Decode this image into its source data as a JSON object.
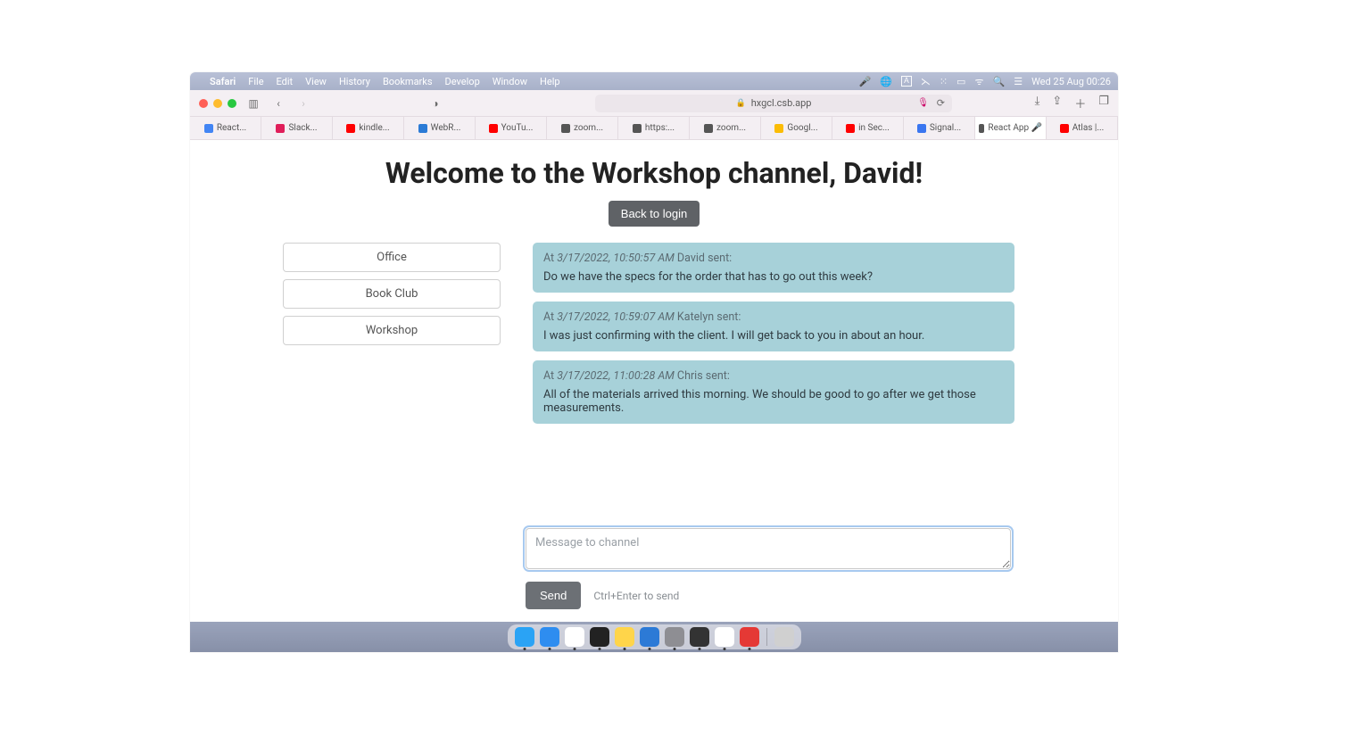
{
  "menubar": {
    "app": "Safari",
    "items": [
      "File",
      "Edit",
      "View",
      "History",
      "Bookmarks",
      "Develop",
      "Window",
      "Help"
    ],
    "clock": "Wed 25 Aug  00:26"
  },
  "toolbar": {
    "address": "hxgcl.csb.app"
  },
  "favorites": [
    {
      "label": "React...",
      "color": "#4285f4"
    },
    {
      "label": "Slack...",
      "color": "#e01e5a"
    },
    {
      "label": "kindle...",
      "color": "#ff0000"
    },
    {
      "label": "WebR...",
      "color": "#2b7bd6"
    },
    {
      "label": "YouTu...",
      "color": "#ff0000"
    },
    {
      "label": "zoom...",
      "color": "#555"
    },
    {
      "label": "https:...",
      "color": "#555"
    },
    {
      "label": "zoom...",
      "color": "#555"
    },
    {
      "label": "Googl...",
      "color": "#fbbc05"
    },
    {
      "label": "in Sec...",
      "color": "#ff0000"
    },
    {
      "label": "Signal...",
      "color": "#3a76f0"
    },
    {
      "label": "React App 🎤",
      "color": "#555",
      "active": true
    },
    {
      "label": "Atlas |...",
      "color": "#ff0000"
    }
  ],
  "page": {
    "title": "Welcome to the Workshop channel, David!",
    "back_label": "Back to login"
  },
  "channels": [
    "Office",
    "Book Club",
    "Workshop"
  ],
  "messages": [
    {
      "at_prefix": "At ",
      "timestamp": "3/17/2022, 10:50:57 AM",
      "sender_suffix": " David sent:",
      "body": "Do we have the specs for the order that has to go out this week?"
    },
    {
      "at_prefix": "At ",
      "timestamp": "3/17/2022, 10:59:07 AM",
      "sender_suffix": " Katelyn sent:",
      "body": "I was just confirming with the client. I will get back to you in about an hour."
    },
    {
      "at_prefix": "At ",
      "timestamp": "3/17/2022, 11:00:28 AM",
      "sender_suffix": " Chris sent:",
      "body": "All of the materials arrived this morning. We should be good to go after we get those measurements."
    }
  ],
  "compose": {
    "placeholder": "Message to channel",
    "send_label": "Send",
    "hint": "Ctrl+Enter to send"
  },
  "dock": {
    "apps": [
      {
        "name": "finder",
        "bg": "#2aa3f5"
      },
      {
        "name": "safari",
        "bg": "#2e8df0"
      },
      {
        "name": "chrome",
        "bg": "#fff"
      },
      {
        "name": "terminal",
        "bg": "#222"
      },
      {
        "name": "notes",
        "bg": "#ffd54a"
      },
      {
        "name": "vscode",
        "bg": "#2c7ad6"
      },
      {
        "name": "settings",
        "bg": "#8e8e93"
      },
      {
        "name": "obs",
        "bg": "#333"
      },
      {
        "name": "textedit",
        "bg": "#fff"
      },
      {
        "name": "photobooth",
        "bg": "#e53935"
      },
      {
        "name": "trash",
        "bg": "#d0d0d0",
        "nodot": true
      }
    ]
  }
}
